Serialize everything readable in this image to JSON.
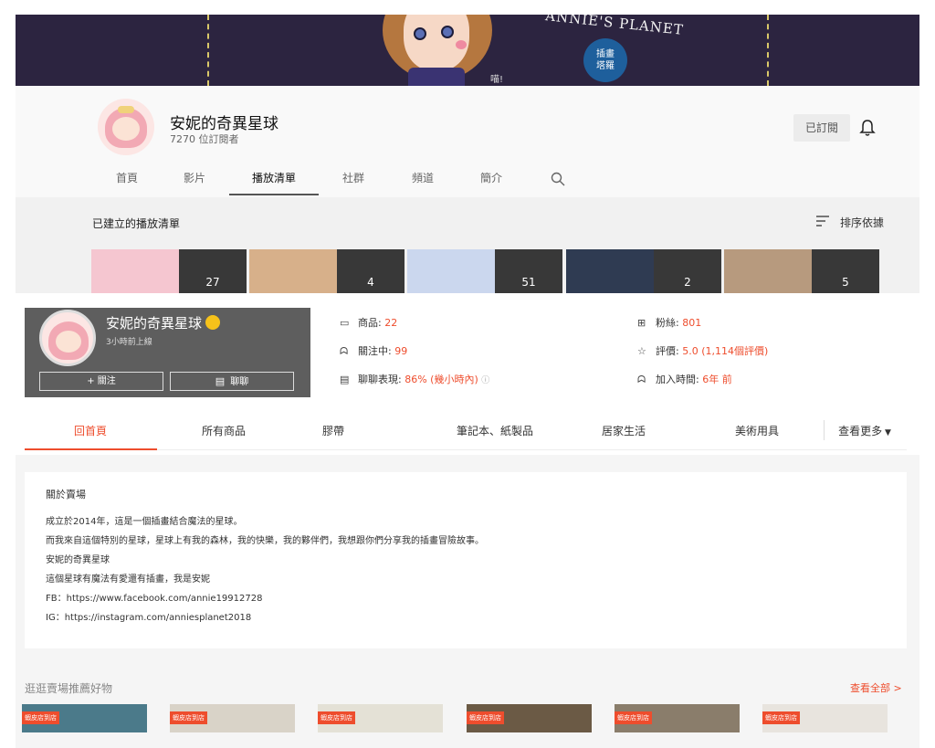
{
  "youtube": {
    "banner": {
      "title": "ANNIE'S PLANET",
      "badge_line1": "插畫",
      "badge_line2": "塔羅",
      "small_text": "喵!"
    },
    "channel_name": "安妮的奇異星球",
    "subscribers": "7270 位訂閱者",
    "subscribed_label": "已訂閱",
    "tabs": [
      "首頁",
      "影片",
      "播放清單",
      "社群",
      "頻道",
      "簡介"
    ],
    "active_tab": "播放清單",
    "section_title": "已建立的播放清單",
    "sort_label": "排序依據",
    "playlists": [
      {
        "count": "27",
        "color": "#f5c6d0"
      },
      {
        "count": "4",
        "color": "#d7b08a"
      },
      {
        "count": "51",
        "color": "#cbd7ee"
      },
      {
        "count": "2",
        "color": "#2f3b52"
      },
      {
        "count": "5",
        "color": "#b79a7e"
      }
    ]
  },
  "shopee": {
    "shop_name": "安妮的奇異星球",
    "last_active": "3小時前上線",
    "follow_label": "+ 關注",
    "chat_label": "聊聊",
    "stats": {
      "products_label": "商品:",
      "products_value": "22",
      "following_label": "關注中:",
      "following_value": "99",
      "chat_label": "聊聊表現:",
      "chat_value": "86% (幾小時內)",
      "followers_label": "粉絲:",
      "followers_value": "801",
      "rating_label": "評價:",
      "rating_value": "5.0 (1,114個評價)",
      "joined_label": "加入時間:",
      "joined_value": "6年 前"
    },
    "tabs": [
      "回首頁",
      "所有商品",
      "膠帶",
      "筆記本、紙製品",
      "居家生活",
      "美術用具"
    ],
    "more_label": "查看更多",
    "about": {
      "title": "關於賣場",
      "lines": [
        "成立於2014年，這是一個插畫結合魔法的星球。",
        "而我來自這個特別的星球，星球上有我的森林，我的快樂，我的夥伴們，我想跟你們分享我的插畫冒險故事。",
        "安妮的奇異星球",
        "這個星球有魔法有愛還有插畫，我是安妮",
        "FB：https://www.facebook.com/annie19912728",
        "IG：https://instagram.com/anniesplanet2018"
      ]
    },
    "recommend_title": "逛逛賣場推薦好物",
    "view_all": "查看全部 >",
    "product_tag": "蝦皮店到店",
    "product_colors": [
      "#4b7a8a",
      "#d9d3c8",
      "#e4e1d6",
      "#6b5a45",
      "#8a7d6b",
      "#e8e4de"
    ]
  },
  "colors": {
    "accent": "#ee4d2d",
    "banner": "#2c2440"
  }
}
